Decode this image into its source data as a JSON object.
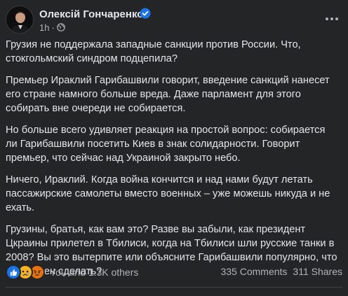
{
  "post": {
    "author": "Олексій Гончаренко",
    "time": "1h",
    "separator": "·",
    "audience_icon": "globe-icon",
    "verified_icon": "verified-badge-icon",
    "more_icon": "more-horizontal-icon",
    "paragraphs": [
      "Грузия не поддержала западные санкции против России. Что, стокгольмский синдром подцепила?",
      "Премьер Ираклий Гарибашвили говорит, введение санкций нанесет его стране намного больше вреда. Даже парламент для этого собирать вне очереди не собирается.",
      "Но больше всего удивляет реакция на простой вопрос: собирается ли Гарибашвили посетить Киев в знак солидарности. Говорит премьер, что сейчас над Украиной закрыто небо.",
      "Ничего, Ираклий. Когда война кончится и над нами будут летать пассажирские самолеты вместо военных – уже можешь никуда и не ехать.",
      "Грузины, братья, как вам это? Разве вы забыли, как президент Цкраины прилетел в Тбилиси, когда на Тбилиси шли русские танки в 2008? Вы это вытерпите или объясните Гарибашвили популярно, что он должен сделать?"
    ]
  },
  "footer": {
    "reactions": [
      "like-icon",
      "sad-icon",
      "angry-icon"
    ],
    "reactions_text": "You and 1.3K others",
    "comments": "335 Comments",
    "shares": "311 Shares"
  },
  "colors": {
    "background": "#242526",
    "text_primary": "#e4e6eb",
    "text_secondary": "#b0b3b8",
    "verified_blue": "#1b74e4",
    "like_blue": "#1b74e4",
    "sad_yellow": "#f7b125",
    "angry_orange": "#e9710f"
  }
}
